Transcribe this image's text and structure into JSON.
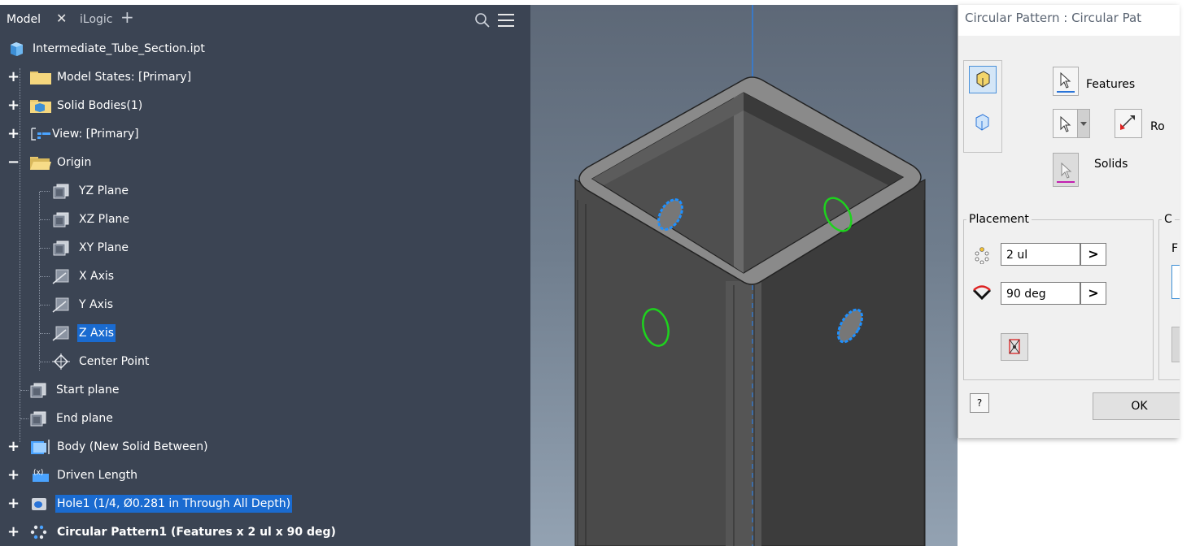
{
  "browser": {
    "tabs": [
      {
        "label": "Model",
        "active": true
      },
      {
        "label": "iLogic",
        "active": false
      }
    ],
    "close_glyph": "✕",
    "add_glyph": "+",
    "search_icon": "search-icon",
    "menu_icon": "hamburger-menu-icon",
    "tree": [
      {
        "label": "Intermediate_Tube_Section.ipt",
        "icon": "part-file-icon",
        "expander": ""
      },
      {
        "label": "Model States: [Primary]",
        "icon": "folder-icon",
        "expander": "+"
      },
      {
        "label": "Solid Bodies(1)",
        "icon": "solid-bodies-folder-icon",
        "expander": "+"
      },
      {
        "label": "View: [Primary]",
        "icon": "view-icon",
        "expander": "+"
      },
      {
        "label": "Origin",
        "icon": "open-folder-icon",
        "expander": "−"
      },
      {
        "label": "YZ Plane",
        "icon": "work-plane-icon",
        "expander": ""
      },
      {
        "label": "XZ Plane",
        "icon": "work-plane-icon",
        "expander": ""
      },
      {
        "label": "XY Plane",
        "icon": "work-plane-icon",
        "expander": ""
      },
      {
        "label": "X Axis",
        "icon": "work-axis-icon",
        "expander": ""
      },
      {
        "label": "Y Axis",
        "icon": "work-axis-icon",
        "expander": ""
      },
      {
        "label": "Z Axis",
        "icon": "work-axis-icon",
        "expander": "",
        "selected": true
      },
      {
        "label": "Center Point",
        "icon": "work-point-icon",
        "expander": ""
      },
      {
        "label": "Start plane",
        "icon": "work-plane-icon",
        "expander": ""
      },
      {
        "label": "End plane",
        "icon": "work-plane-icon",
        "expander": ""
      },
      {
        "label": "Body (New Solid Between)",
        "icon": "body-feature-icon",
        "expander": "+"
      },
      {
        "label": "Driven Length",
        "icon": "driven-parameter-icon",
        "expander": "+"
      },
      {
        "label": "Hole1 (1/4, Ø0.281 in Through All Depth)",
        "icon": "hole-feature-icon",
        "expander": "+",
        "selected": true
      },
      {
        "label": "Circular Pattern1 (Features x 2 ul x 90 deg)",
        "icon": "circular-pattern-icon",
        "expander": "+",
        "bold": true
      }
    ]
  },
  "dialog": {
    "title": "Circular Pattern : Circular Pat",
    "features_label": "Features",
    "rotation_label": "Ro",
    "solids_label": "Solids",
    "placement_label": "Placement",
    "other_group_label": "C",
    "other_field_label": "F",
    "count_value": "2 ul",
    "angle_value": "90 deg",
    "arrow_glyph": ">",
    "help_glyph": "?",
    "ok_label": "OK"
  },
  "colors": {
    "browser_bg": "#3b4453",
    "selection": "#1a6bd0",
    "viewport_top": "#5d6877",
    "viewport_bottom": "#93a2b2",
    "hole_selected": "#1e90ff",
    "hole_preview": "#1ed21e"
  }
}
